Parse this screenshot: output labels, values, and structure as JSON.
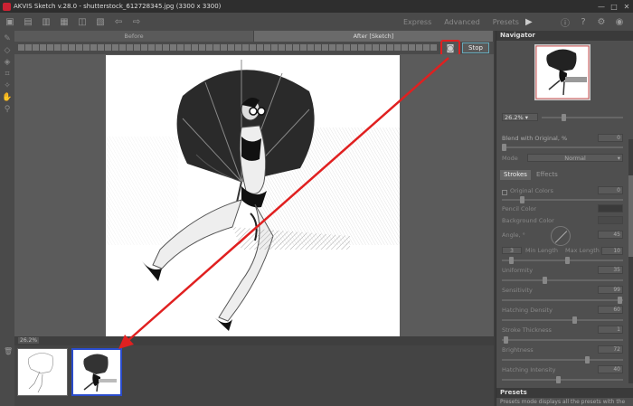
{
  "window": {
    "title": "AKVIS Sketch v.28.0 - shutterstock_612728345.jpg (3300 x 3300)",
    "controls": [
      "—",
      "□",
      "✕"
    ]
  },
  "toolbar": {
    "modes": [
      "Express",
      "Advanced",
      "Presets"
    ]
  },
  "tabs": [
    "Before",
    "After [Sketch]"
  ],
  "stop_label": "Stop",
  "zoom_status": "26.2%",
  "navigator": {
    "title": "Navigator",
    "zoom": "26.2%"
  },
  "settings": {
    "blend_label": "Blend with Original, %",
    "blend_value": "0",
    "mode_label": "Mode",
    "mode_value": "Normal",
    "tabs": [
      "Strokes",
      "Effects"
    ],
    "original_colors": "Original Colors",
    "original_colors_value": "0",
    "pencil_color": "Pencil Color",
    "background_color": "Background Color",
    "angle_label": "Angle, °",
    "angle_value": "45",
    "min_length": "Min Length",
    "max_length": "Max Length",
    "min_length_value": "3",
    "max_length_value": "10",
    "sliders": [
      {
        "label": "Uniformity",
        "value": "35"
      },
      {
        "label": "Sensitivity",
        "value": "99"
      },
      {
        "label": "Hatching Density",
        "value": "60"
      },
      {
        "label": "Stroke Thickness",
        "value": "1"
      },
      {
        "label": "Brightness",
        "value": "72"
      },
      {
        "label": "Hatching Intensity",
        "value": "40"
      }
    ]
  },
  "presets": {
    "title": "Presets",
    "text": "Presets mode displays all the presets with the"
  },
  "colors": {
    "highlight_red": "#e02020",
    "selection_blue": "#2a4ccc"
  }
}
